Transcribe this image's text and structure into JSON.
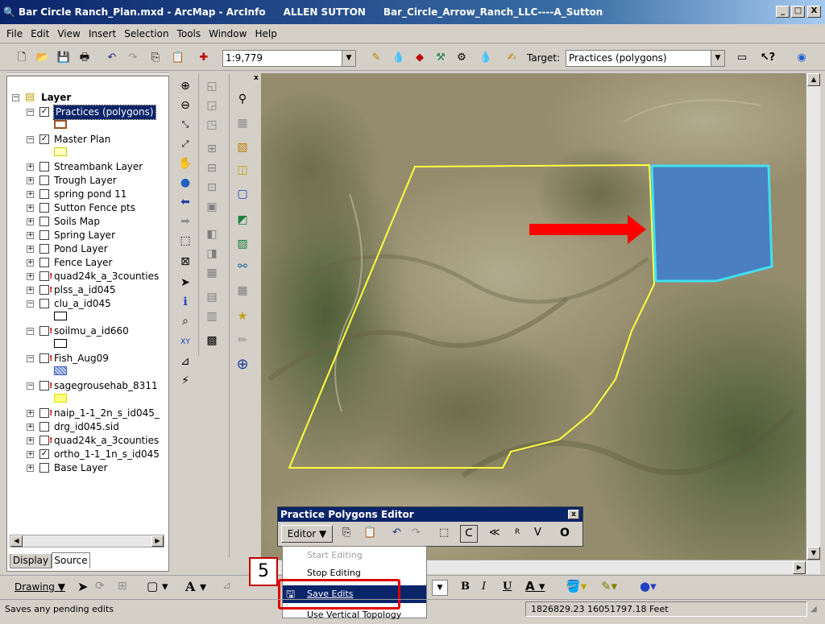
{
  "window": {
    "title": "Bar Circle Ranch_Plan.mxd - ArcMap - ArcInfo",
    "user": "ALLEN SUTTON",
    "project": "Bar_Circle_Arrow_Ranch_LLC----A_Sutton",
    "minimize": "_",
    "maximize": "□",
    "close": "X"
  },
  "menu": [
    "File",
    "Edit",
    "View",
    "Insert",
    "Selection",
    "Tools",
    "Window",
    "Help"
  ],
  "toolbar": {
    "scale": "1:9,779",
    "target_label": "Target:",
    "target_value": "Practices (polygons)"
  },
  "toc": {
    "root": "Layer",
    "layers": [
      {
        "name": "Practices (polygons)",
        "checked": true,
        "expanded": true,
        "selected": true
      },
      {
        "name": "Master Plan",
        "checked": true,
        "expanded": true
      },
      {
        "name": "Streambank Layer",
        "checked": false
      },
      {
        "name": "Trough Layer",
        "checked": false
      },
      {
        "name": "spring pond 11",
        "checked": false
      },
      {
        "name": "Sutton Fence pts",
        "checked": false
      },
      {
        "name": "Soils Map",
        "checked": false
      },
      {
        "name": "Spring Layer",
        "checked": false
      },
      {
        "name": "Pond Layer",
        "checked": false
      },
      {
        "name": "Fence Layer",
        "checked": false
      },
      {
        "name": "quad24k_a_3counties",
        "checked": false
      },
      {
        "name": "plss_a_id045",
        "checked": false
      },
      {
        "name": "clu_a_id045",
        "checked": false,
        "expanded": true
      },
      {
        "name": "soilmu_a_id660",
        "checked": false,
        "expanded": true
      },
      {
        "name": "Fish_Aug09",
        "checked": false,
        "expanded": true
      },
      {
        "name": "sagegrousehab_8311",
        "checked": false,
        "expanded": true
      },
      {
        "name": "naip_1-1_2n_s_id045_",
        "checked": false
      },
      {
        "name": "drg_id045.sid",
        "checked": false
      },
      {
        "name": "quad24k_a_3counties",
        "checked": false
      },
      {
        "name": "ortho_1-1_1n_s_id045",
        "checked": true
      },
      {
        "name": "Base Layer",
        "checked": false
      }
    ],
    "tabs": [
      "Display",
      "Source"
    ]
  },
  "editor_window": {
    "title": "Practice Polygons Editor",
    "editor_button": "Editor ▼",
    "close": "x"
  },
  "editor_menu": {
    "items": [
      {
        "label": "Start Editing",
        "enabled": false
      },
      {
        "label": "Stop Editing",
        "enabled": true
      },
      {
        "label": "Save Edits",
        "enabled": true,
        "highlighted": true
      },
      {
        "label": "Use Vertical Topology",
        "enabled": true
      }
    ]
  },
  "step_badge": "5",
  "drawing": {
    "label": "Drawing ▼",
    "font_a": "A",
    "bold": "B",
    "italic": "I",
    "underline": "U"
  },
  "status": {
    "message": "Saves any pending edits",
    "coords": "1826829.23  16051797.18 Feet"
  },
  "colors": {
    "boundary": "#ffff40",
    "practice_fill": "#4a7fc1",
    "practice_outline": "#40e0f0",
    "arrow": "#ff0000",
    "highlight_box": "#e00000"
  }
}
